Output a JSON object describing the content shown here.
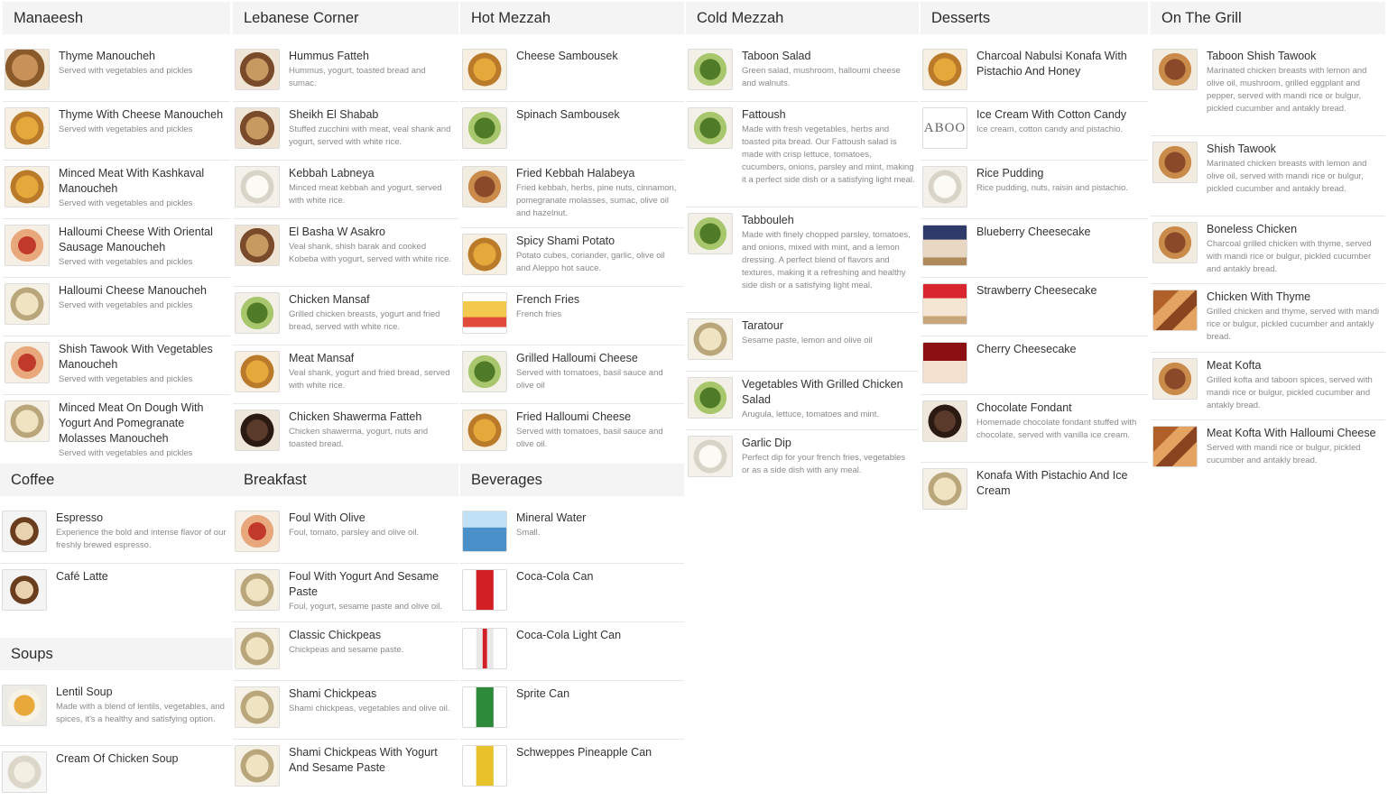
{
  "sections": {
    "manaeesh": {
      "title": "Manaeesh",
      "items": [
        {
          "name": "Thyme Manoucheh",
          "desc": "Served with vegetables and pickles"
        },
        {
          "name": "Thyme With Cheese Manoucheh",
          "desc": "Served with vegetables and pickles"
        },
        {
          "name": "Minced Meat With Kashkaval Manoucheh",
          "desc": "Served with vegetables and pickles"
        },
        {
          "name": "Halloumi Cheese With Oriental Sausage Manoucheh",
          "desc": "Served with vegetables and pickles"
        },
        {
          "name": "Halloumi Cheese Manoucheh",
          "desc": "Served with vegetables and pickles"
        },
        {
          "name": "Shish Tawook With Vegetables Manoucheh",
          "desc": "Served with vegetables and pickles"
        },
        {
          "name": "Minced Meat On Dough With Yogurt And Pomegranate Molasses Manoucheh",
          "desc": "Served with vegetables and pickles"
        }
      ]
    },
    "lebanese": {
      "title": "Lebanese Corner",
      "items": [
        {
          "name": "Hummus Fatteh",
          "desc": "Hummus, yogurt, toasted bread and sumac."
        },
        {
          "name": "Sheikh El Shabab",
          "desc": "Stuffed zucchini with meat, veal shank and yogurt, served with white rice."
        },
        {
          "name": "Kebbah Labneya",
          "desc": "Minced meat kebbah and yogurt, served with white rice."
        },
        {
          "name": "El Basha W Asakro",
          "desc": "Veal shank, shish barak and cooked Kobeba with yogurt, served with white rice."
        },
        {
          "name": "Chicken Mansaf",
          "desc": "Grilled chicken breasts, yogurt and fried bread, served with white rice."
        },
        {
          "name": "Meat Mansaf",
          "desc": "Veal shank, yogurt and fried bread, served with white rice."
        },
        {
          "name": "Chicken Shawerma Fatteh",
          "desc": "Chicken shawerma, yogurt, nuts and toasted bread."
        }
      ]
    },
    "hotmezzah": {
      "title": "Hot Mezzah",
      "items": [
        {
          "name": "Cheese Sambousek",
          "desc": ""
        },
        {
          "name": "Spinach Sambousek",
          "desc": ""
        },
        {
          "name": "Fried Kebbah Halabeya",
          "desc": "Fried kebbah, herbs, pine nuts, cinnamon, pomegranate molasses, sumac, olive oil and hazelnut."
        },
        {
          "name": "Spicy Shami Potato",
          "desc": "Potato cubes, coriander, garlic, olive oil and Aleppo hot sauce."
        },
        {
          "name": "French Fries",
          "desc": "French fries"
        },
        {
          "name": "Grilled Halloumi Cheese",
          "desc": "Served with tomatoes, basil sauce and olive oil"
        },
        {
          "name": "Fried Halloumi Cheese",
          "desc": "Served with tomatoes, basil sauce and olive oil."
        }
      ]
    },
    "coldmezzah": {
      "title": "Cold Mezzah",
      "items": [
        {
          "name": "Taboon Salad",
          "desc": "Green salad, mushroom, halloumi cheese and walnuts."
        },
        {
          "name": "Fattoush",
          "desc": "Made with fresh vegetables, herbs and toasted pita bread. Our Fattoush salad is made with crisp lettuce, tomatoes, cucumbers, onions, parsley and mint, making it a perfect side dish or a satisfying light meal."
        },
        {
          "name": "Tabbouleh",
          "desc": "Made with finely chopped parsley, tomatoes, and onions, mixed with mint, and a lemon dressing. A perfect blend of flavors and textures, making it a refreshing and healthy side dish or a satisfying light meal."
        },
        {
          "name": "Taratour",
          "desc": "Sesame paste, lemon and olive oil"
        },
        {
          "name": "Vegetables With Grilled Chicken Salad",
          "desc": "Arugula, lettuce, tomatoes and mint."
        },
        {
          "name": "Garlic Dip",
          "desc": "Perfect dip for your french fries, vegetables or as a side dish with any meal."
        }
      ]
    },
    "desserts": {
      "title": "Desserts",
      "items": [
        {
          "name": "Charcoal Nabulsi Konafa With Pistachio And Honey",
          "desc": ""
        },
        {
          "name": "Ice Cream With Cotton Candy",
          "desc": "Ice cream, cotton candy and pistachio."
        },
        {
          "name": "Rice Pudding",
          "desc": "Rice pudding, nuts, raisin and pistachio."
        },
        {
          "name": "Blueberry Cheesecake",
          "desc": ""
        },
        {
          "name": "Strawberry Cheesecake",
          "desc": ""
        },
        {
          "name": "Cherry Cheesecake",
          "desc": ""
        },
        {
          "name": "Chocolate Fondant",
          "desc": "Homemade chocolate fondant stuffed with chocolate, served with vanilla ice cream."
        },
        {
          "name": "Konafa With Pistachio And Ice Cream",
          "desc": ""
        }
      ],
      "icecream_logo_text": "ABOO"
    },
    "grill": {
      "title": "On The Grill",
      "items": [
        {
          "name": "Taboon Shish Tawook",
          "desc": "Marinated chicken breasts with lemon and olive oil, mushroom, grilled eggplant and pepper, served with mandi rice or bulgur, pickled cucumber and antakly bread."
        },
        {
          "name": "Shish Tawook",
          "desc": "Marinated chicken breasts with lemon and olive oil, served with mandi rice or bulgur, pickled cucumber and antakly bread."
        },
        {
          "name": "Boneless Chicken",
          "desc": "Charcoal grilled chicken with thyme, served with mandi rice or bulgur, pickled cucumber and antakly bread."
        },
        {
          "name": "Chicken With Thyme",
          "desc": "Grilled chicken and thyme, served with mandi rice or bulgur, pickled cucumber and antakly bread."
        },
        {
          "name": "Meat Kofta",
          "desc": "Grilled kofta and taboon spices, served with mandi rice or bulgur, pickled cucumber and antakly bread."
        },
        {
          "name": "Meat Kofta With Halloumi Cheese",
          "desc": "Served with mandi rice or bulgur, pickled cucumber and antakly bread."
        }
      ]
    },
    "coffee": {
      "title": "Coffee",
      "items": [
        {
          "name": "Espresso",
          "desc": "Experience the bold and intense flavor of our freshly brewed espresso."
        },
        {
          "name": "Café Latte",
          "desc": ""
        }
      ]
    },
    "soups": {
      "title": "Soups",
      "items": [
        {
          "name": "Lentil Soup",
          "desc": "Made with a blend of lentils, vegetables, and spices, it's a healthy and satisfying option."
        },
        {
          "name": "Cream Of Chicken Soup",
          "desc": ""
        }
      ]
    },
    "breakfast": {
      "title": "Breakfast",
      "items": [
        {
          "name": "Foul With Olive",
          "desc": "Foul, tomato, parsley and olive oil."
        },
        {
          "name": "Foul With Yogurt And Sesame Paste",
          "desc": "Foul, yogurt, sesame paste and olive oil."
        },
        {
          "name": "Classic Chickpeas",
          "desc": "Chickpeas and sesame paste."
        },
        {
          "name": "Shami Chickpeas",
          "desc": "Shami chickpeas, vegetables and olive oil."
        },
        {
          "name": "Shami Chickpeas With Yogurt And Sesame Paste",
          "desc": ""
        }
      ]
    },
    "beverages": {
      "title": "Beverages",
      "items": [
        {
          "name": "Mineral Water",
          "desc": "Small."
        },
        {
          "name": "Coca-Cola Can",
          "desc": ""
        },
        {
          "name": "Coca-Cola Light Can",
          "desc": ""
        },
        {
          "name": "Sprite Can",
          "desc": ""
        },
        {
          "name": "Schweppes Pineapple Can",
          "desc": ""
        }
      ]
    }
  }
}
